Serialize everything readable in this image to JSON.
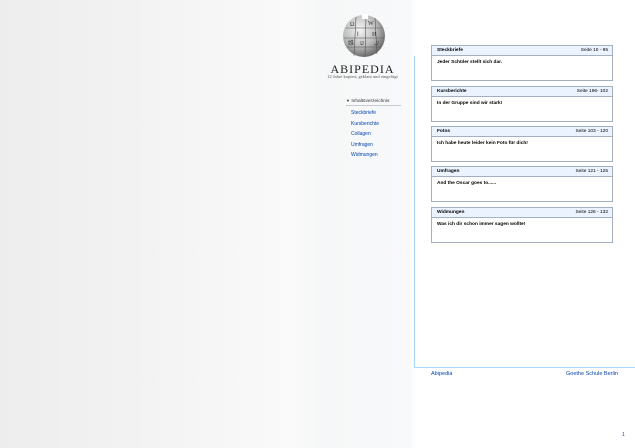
{
  "brand": {
    "name": "Abipedia",
    "subtitle": "12 Jahre kopiert, geklaut und eingefügt"
  },
  "sidebar": {
    "heading": "Inhaltsverzeichnis",
    "items": [
      {
        "label": "Steckbriefe"
      },
      {
        "label": "Kursberichte"
      },
      {
        "label": "Collagen"
      },
      {
        "label": "Umfragen"
      },
      {
        "label": "Widmungen"
      }
    ]
  },
  "sections": [
    {
      "title": "Steckbriefe",
      "pages": "Seite 10 - 95",
      "text": "Jeder Schüler stellt sich dar."
    },
    {
      "title": "Kursberichte",
      "pages": "Seite 196- 102",
      "text": "In der Gruppe sind wir stark!"
    },
    {
      "title": "Fotos",
      "pages": "Seite 103 - 120",
      "text": "Ich habe heute leider kein Foto für dich!"
    },
    {
      "title": "Umfragen",
      "pages": "Seite 121 - 125",
      "text": "And the Oscar goes to......"
    },
    {
      "title": "Widmungen",
      "pages": "Seite 126 - 132",
      "text": "Was ich dir schon immer sagen wollte!"
    }
  ],
  "footer": {
    "left": "Abipedia",
    "right": "Goethe Schule Berlin",
    "page_number": "1"
  }
}
